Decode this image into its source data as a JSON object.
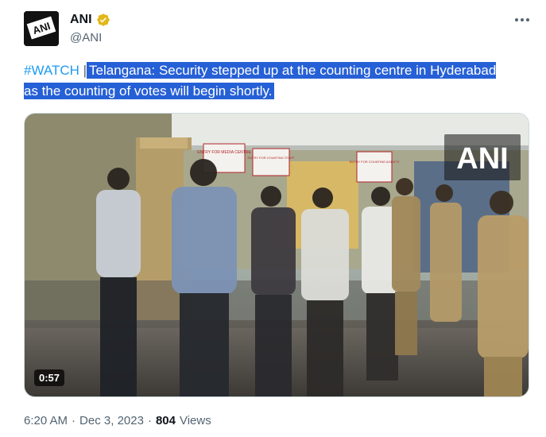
{
  "author": {
    "display_name": "ANI",
    "handle": "@ANI",
    "verified": true,
    "avatar_icon": "ani-logo-icon",
    "logo_text": "ANI"
  },
  "post": {
    "hashtag": "#WATCH",
    "separator": "|",
    "text": "Telangana: Security stepped up at the counting centre in Hyderabad as the counting of votes will begin shortly."
  },
  "media": {
    "type": "video",
    "duration": "0:57",
    "watermark": "ANI",
    "signs": [
      "ENTRY FOR MEDIA CENTRE",
      "ENTRY FOR COUNTING STAFF",
      "ENTRY FOR COUNTING AGENTS"
    ]
  },
  "meta": {
    "time": "6:20 AM",
    "dot": "·",
    "date": "Dec 3, 2023",
    "views_count": "804",
    "views_label": "Views"
  },
  "colors": {
    "link": "#1d9bf0",
    "selection": "#2660d6",
    "verified_badge": "#e2b719",
    "secondary_text": "#536471"
  }
}
